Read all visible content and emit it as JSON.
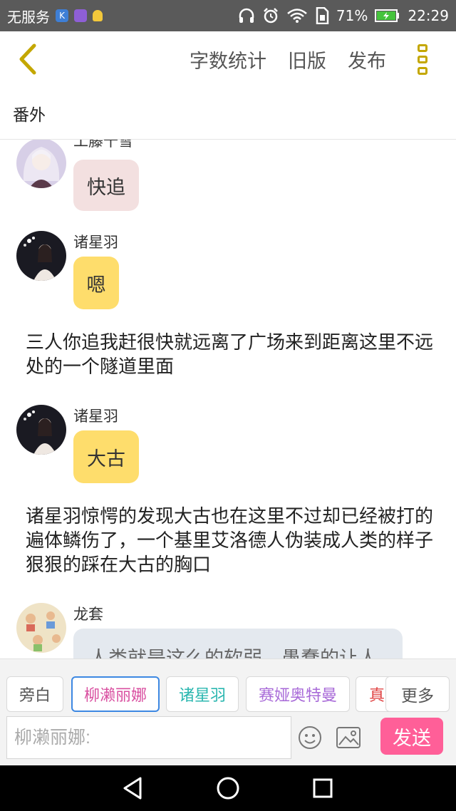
{
  "status": {
    "carrier": "无服务",
    "battery": "71%",
    "time": "22:29",
    "icons": [
      "k-app-icon",
      "gallery-icon",
      "bulb-icon",
      "headphones-icon",
      "alarm-icon",
      "wifi-icon",
      "sim-icon",
      "battery-icon"
    ]
  },
  "appbar": {
    "word_count": "字数统计",
    "old_version": "旧版",
    "publish": "发布"
  },
  "chapter": {
    "title": "番外"
  },
  "messages": [
    {
      "name": "工藤千雪",
      "text": "快追"
    },
    {
      "name": "诸星羽",
      "text": "嗯"
    },
    {
      "narration": "三人你追我赶很快就远离了广场来到距离这里不远处的一个隧道里面"
    },
    {
      "name": "诸星羽",
      "text": "大古"
    },
    {
      "narration": "诸星羽惊愕的发现大古也在这里不过却已经被打的遍体鳞伤了，一个基里艾洛德人伪装成人类的样子狠狠的踩在大古的胸口"
    },
    {
      "name": "龙套",
      "text": "人类就是这么的软弱，愚蠢的让人"
    }
  ],
  "colors": {
    "bubble_pink": "#f3e0e0",
    "bubble_yellow": "#fedd6c",
    "bubble_gray": "#e4e9ef",
    "send": "#ff5f98",
    "selected_border": "#3d88e2"
  },
  "roles": [
    {
      "label": "旁白",
      "color": "#555555"
    },
    {
      "label": "柳濑丽娜",
      "color": "#d94fa0"
    },
    {
      "label": "诸星羽",
      "color": "#2bb7b0"
    },
    {
      "label": "赛娅奥特曼",
      "color": "#a86ad8"
    },
    {
      "label": "真",
      "color": "#e04444"
    }
  ],
  "more_roles": "更多",
  "input": {
    "placeholder": "柳濑丽娜:"
  },
  "send_label": "发送"
}
